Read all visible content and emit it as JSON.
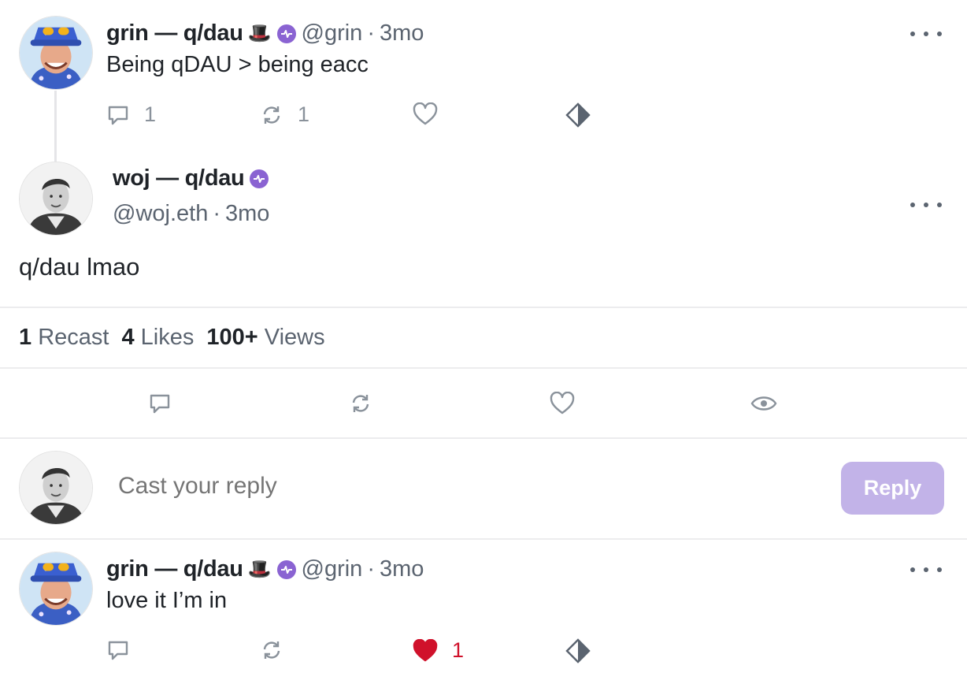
{
  "posts": [
    {
      "author": "grin — q/dau",
      "hat": "🎩",
      "handle": "@grin",
      "sep": "·",
      "time": "3mo",
      "text": "Being qDAU > being eacc",
      "replies": "1",
      "recasts": "1",
      "likes": "",
      "liked": false
    },
    {
      "author": "grin — q/dau",
      "hat": "🎩",
      "handle": "@grin",
      "sep": "·",
      "time": "3mo",
      "text": "love it I’m in",
      "replies": "",
      "recasts": "",
      "likes": "1",
      "liked": true
    }
  ],
  "main_post": {
    "author": "woj — q/dau",
    "handle": "@woj.eth",
    "sep": "·",
    "time": "3mo",
    "text": "q/dau lmao"
  },
  "stats": {
    "recasts_count": "1",
    "recasts_label": "Recast",
    "likes_count": "4",
    "likes_label": "Likes",
    "views_count": "100+",
    "views_label": "Views"
  },
  "reply": {
    "placeholder": "Cast your reply",
    "button_label": "Reply"
  },
  "colors": {
    "verified": "#8a63d2",
    "like_active": "#d0112b",
    "reply_button": "#c2b3e8"
  },
  "icons": {
    "reply": "comment-icon",
    "recast": "recast-icon",
    "like": "heart-icon",
    "bookmark": "diamond-icon",
    "views": "eye-icon",
    "verified": "verified-badge-icon",
    "more": "more-icon"
  }
}
